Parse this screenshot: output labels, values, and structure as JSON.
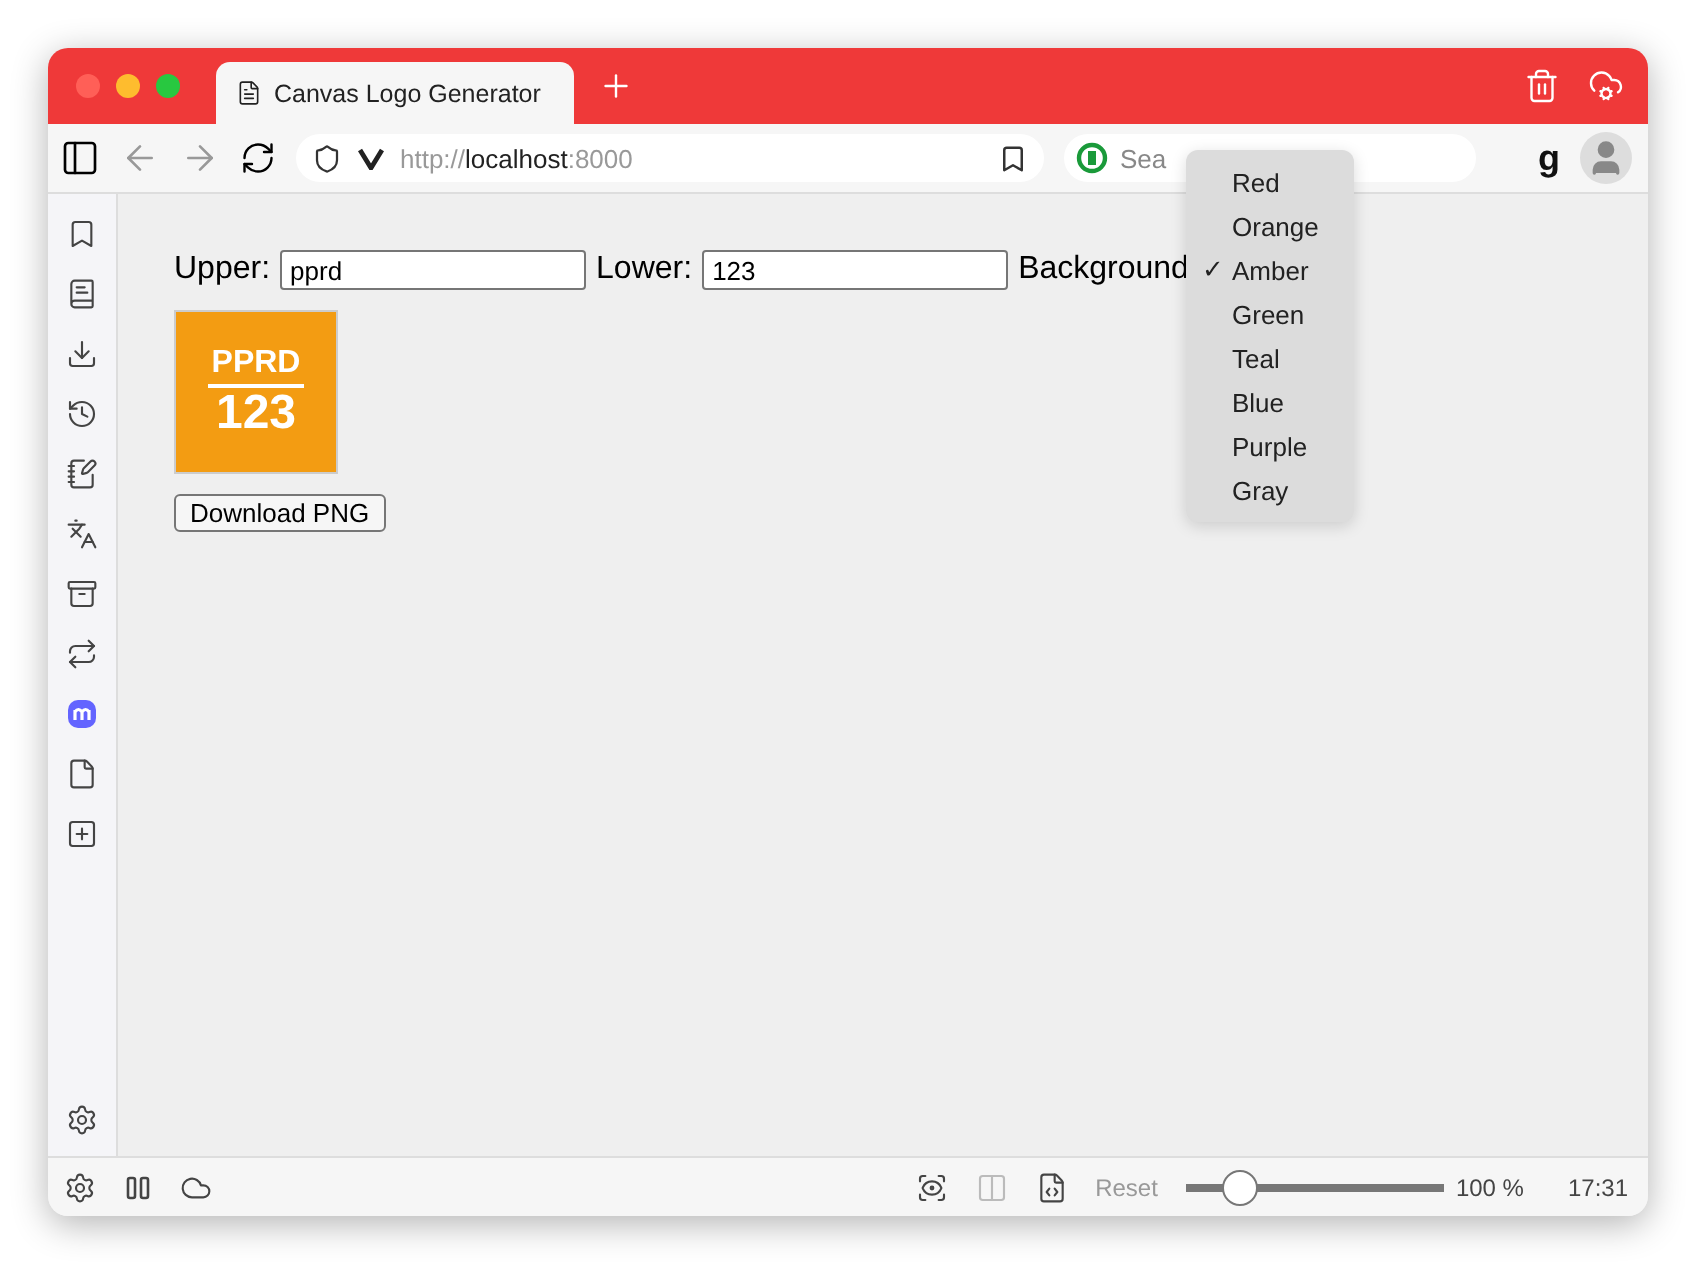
{
  "window": {
    "title": "Canvas Logo Generator"
  },
  "toolbar": {
    "url_scheme": "http://",
    "url_host": "localhost",
    "url_port": ":8000",
    "search": {
      "placeholder": "Sea"
    },
    "extension_glyph": "g"
  },
  "form": {
    "upper_label": "Upper:",
    "upper_value": "pprd",
    "lower_label": "Lower:",
    "lower_value": "123",
    "background_label": "Background"
  },
  "logo": {
    "upper": "PPRD",
    "lower": "123",
    "color": "#f39c12"
  },
  "download_button": "Download PNG",
  "dropdown": {
    "check": "✓",
    "options": [
      {
        "label": "Red",
        "selected": false
      },
      {
        "label": "Orange",
        "selected": false
      },
      {
        "label": "Amber",
        "selected": true
      },
      {
        "label": "Green",
        "selected": false
      },
      {
        "label": "Teal",
        "selected": false
      },
      {
        "label": "Blue",
        "selected": false
      },
      {
        "label": "Purple",
        "selected": false
      },
      {
        "label": "Gray",
        "selected": false
      }
    ]
  },
  "status_bar": {
    "reset": "Reset",
    "zoom": {
      "level": 0.21
    },
    "zoom_text": "100 %",
    "clock": "17:31"
  }
}
